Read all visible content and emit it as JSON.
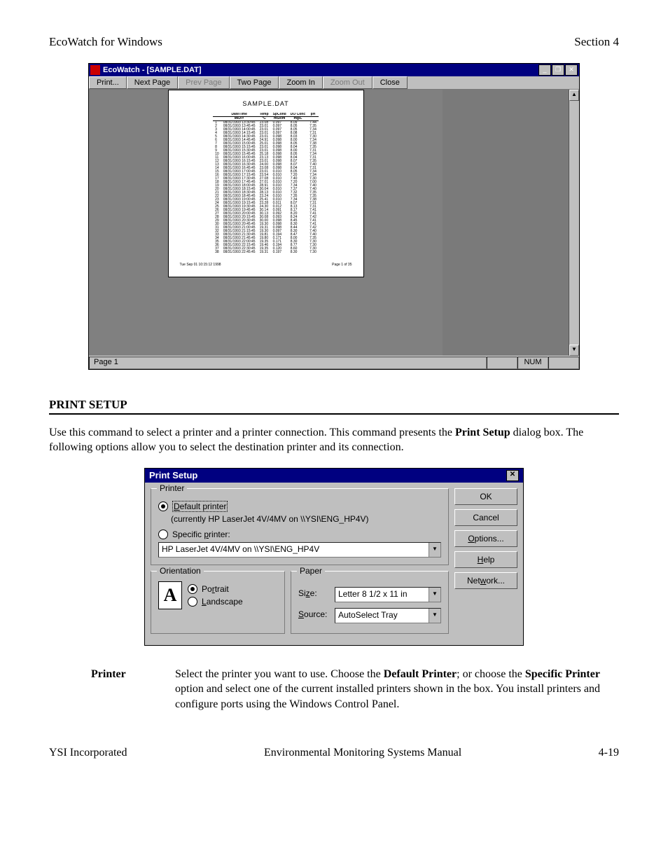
{
  "header": {
    "left": "EcoWatch for Windows",
    "right": "Section 4"
  },
  "ecowatch": {
    "title": "EcoWatch - [SAMPLE.DAT]",
    "winbtns": {
      "min": "_",
      "max": "❐",
      "close": "✕"
    },
    "toolbar": {
      "print": "Print...",
      "next": "Next Page",
      "prev": "Prev Page",
      "two": "Two Page",
      "zin": "Zoom In",
      "zout": "Zoom Out",
      "close": "Close"
    },
    "doc": {
      "title": "SAMPLE.DAT",
      "headers": [
        "",
        "DateTime",
        "Temp",
        "SpCond",
        "DO Conc",
        "pH"
      ],
      "sub": [
        "",
        "M/D/Y",
        "°C",
        "mS/cm",
        "mg/L",
        ""
      ],
      "rows": [
        [
          "1",
          "08/31/1993 13:30:45",
          "23.08",
          "0.097",
          "8.09",
          "7.44"
        ],
        [
          "2",
          "08/31/1993 13:45:45",
          "23.01",
          "0.097",
          "8.05",
          "7.35"
        ],
        [
          "3",
          "08/31/1993 14:00:45",
          "23.01",
          "0.097",
          "8.05",
          "7.34"
        ],
        [
          "4",
          "08/31/1993 14:15:45",
          "23.01",
          "0.097",
          "8.08",
          "7.31"
        ],
        [
          "5",
          "08/31/1993 14:30:45",
          "23.01",
          "0.098",
          "8.03",
          "7.30"
        ],
        [
          "6",
          "08/31/1993 14:45:45",
          "24.91",
          "0.098",
          "8.00",
          "7.34"
        ],
        [
          "7",
          "08/31/1993 15:00:45",
          "25.01",
          "0.098",
          "8.05",
          "7.38"
        ],
        [
          "8",
          "08/31/1993 15:15:45",
          "23.01",
          "0.098",
          "8.04",
          "7.35"
        ],
        [
          "9",
          "08/31/1993 15:30:45",
          "23.01",
          "0.098",
          "8.00",
          "7.31"
        ],
        [
          "10",
          "08/31/1993 15:45:45",
          "25.18",
          "0.098",
          "8.05",
          "7.34"
        ],
        [
          "11",
          "08/31/1993 16:00:45",
          "23.13",
          "0.098",
          "8.04",
          "7.31"
        ],
        [
          "12",
          "08/31/1993 16:15:45",
          "23.01",
          "0.098",
          "8.07",
          "7.35"
        ],
        [
          "13",
          "08/31/1993 16:30:45",
          "24.00",
          "0.098",
          "8.07",
          "7.40"
        ],
        [
          "14",
          "08/31/1993 16:45:45",
          "23.08",
          "0.098",
          "8.04",
          "7.31"
        ],
        [
          "15",
          "08/31/1993 17:00:45",
          "23.01",
          "0.010",
          "8.05",
          "7.34"
        ],
        [
          "16",
          "08/31/1993 17:15:45",
          "23.54",
          "0.010",
          "7.20",
          "7.34"
        ],
        [
          "17",
          "08/31/1993 17:30:45",
          "27.08",
          "0.010",
          "7.40",
          "7.30"
        ],
        [
          "18",
          "08/31/1993 17:45:45",
          "27.01",
          "0.010",
          "7.20",
          "7.00"
        ],
        [
          "19",
          "08/31/1993 18:00:45",
          "28.91",
          "0.010",
          "7.34",
          "7.40"
        ],
        [
          "20",
          "08/31/1993 18:15:45",
          "30.04",
          "0.010",
          "7.37",
          "7.40"
        ],
        [
          "21",
          "08/31/1993 18:30:45",
          "28.13",
          "0.010",
          "7.32",
          "7.35"
        ],
        [
          "22",
          "08/31/1993 18:45:45",
          "23.24",
          "0.010",
          "7.35",
          "7.35"
        ],
        [
          "23",
          "08/31/1993 19:00:45",
          "25.41",
          "0.010",
          "7.34",
          "7.38"
        ],
        [
          "24",
          "08/31/1993 19:15:45",
          "23.28",
          "0.011",
          "8.07",
          "7.31"
        ],
        [
          "25",
          "08/31/1993 19:30:45",
          "24.30",
          "0.012",
          "8.13",
          "7.31"
        ],
        [
          "26",
          "08/31/1993 19:45:45",
          "30.14",
          "0.091",
          "8.17",
          "7.41"
        ],
        [
          "27",
          "08/31/1993 20:00:45",
          "30.13",
          "0.092",
          "8.20",
          "7.41"
        ],
        [
          "28",
          "08/31/1993 20:15:45",
          "30.08",
          "0.093",
          "8.24",
          "7.42"
        ],
        [
          "29",
          "08/31/1993 20:30:45",
          "30.00",
          "0.098",
          "8.45",
          "7.41"
        ],
        [
          "30",
          "08/31/1993 20:45:45",
          "19.30",
          "0.098",
          "8.30",
          "7.41"
        ],
        [
          "31",
          "08/31/1993 21:00:45",
          "19.31",
          "0.098",
          "8.44",
          "7.42"
        ],
        [
          "32",
          "08/31/1993 21:15:45",
          "19.30",
          "0.097",
          "8.30",
          "7.40"
        ],
        [
          "33",
          "08/31/1993 21:30:45",
          "19.81",
          "0.194",
          "8.47",
          "7.40"
        ],
        [
          "34",
          "08/31/1993 21:45:45",
          "19.80",
          "0.171",
          "8.00",
          "7.35"
        ],
        [
          "35",
          "08/31/1993 22:00:45",
          "19.35",
          "0.171",
          "8.30",
          "7.30"
        ],
        [
          "36",
          "08/31/1993 22:15:45",
          "19.46",
          "0.194",
          "8.77",
          "7.30"
        ],
        [
          "37",
          "08/31/1993 22:30:45",
          "19.35",
          "0.120",
          "8.60",
          "7.30"
        ],
        [
          "38",
          "08/31/1993 22:45:45",
          "19.31",
          "0.197",
          "8.30",
          "7.30"
        ]
      ],
      "footer_left": "Tue Sep 01 10:15:12 1998",
      "footer_right": "Page 1 of 35"
    },
    "status": {
      "left": "Page 1",
      "num": "NUM"
    }
  },
  "section": {
    "title": "PRINT SETUP",
    "p1_a": "Use this command to select a printer and a printer connection.  This command presents the ",
    "p1_b": "Print Setup",
    "p1_c": " dialog box.  The following options allow you to select the destination printer and its connection."
  },
  "dlg": {
    "title": "Print Setup",
    "printer_legend": "Printer",
    "default_u": "D",
    "default_rest": "efault printer",
    "currently": "(currently HP LaserJet 4V/4MV on \\\\YSI\\ENG_HP4V)",
    "specific_pre": "Specific ",
    "specific_u": "p",
    "specific_post": "rinter:",
    "printer_value": "HP LaserJet 4V/4MV on \\\\YSI\\ENG_HP4V",
    "orient_legend": "Orientation",
    "portrait_pre": "Po",
    "portrait_u": "r",
    "portrait_post": "trait",
    "landscape_u": "L",
    "landscape_rest": "andscape",
    "paper_legend": "Paper",
    "size_pre": "Si",
    "size_u": "z",
    "size_post": "e:",
    "size_value": "Letter 8 1/2 x 11 in",
    "source_u": "S",
    "source_rest": "ource:",
    "source_value": "AutoSelect Tray",
    "ok": "OK",
    "cancel": "Cancel",
    "options_u": "O",
    "options_rest": "ptions...",
    "help_u": "H",
    "help_rest": "elp",
    "network_pre": "Net",
    "network_u": "w",
    "network_post": "ork...",
    "orient_icon": "A"
  },
  "desc": {
    "term": "Printer",
    "t1": "Select the printer you want to use.  Choose the ",
    "b1": "Default Printer",
    "t2": "; or choose the ",
    "b2": "Specific Printer",
    "t3": " option and select one of the current installed printers shown in the box.  You install printers and configure ports using the Windows Control Panel."
  },
  "footer": {
    "left": "YSI Incorporated",
    "center": "Environmental Monitoring Systems Manual",
    "right": "4-19"
  }
}
